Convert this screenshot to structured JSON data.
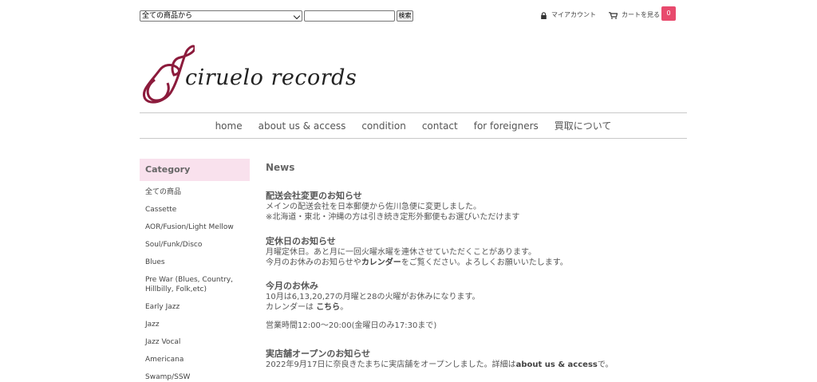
{
  "topbar": {
    "search_select_value": "全ての商品から",
    "search_button": "検索",
    "account_label": "マイアカウント",
    "cart_label": "カートを見る",
    "cart_count": "0"
  },
  "brand": {
    "logo_text": "ciruelo records",
    "logo_color": "#8c1b3c"
  },
  "nav": {
    "items": [
      "home",
      "about us & access",
      "condition",
      "contact",
      "for foreigners",
      "買取について"
    ]
  },
  "sidebar": {
    "header": "Category",
    "items": [
      "全ての商品",
      "Cassette",
      "AOR/Fusion/Light Mellow",
      "Soul/Funk/Disco",
      "Blues",
      "Pre War (Blues, Country, Hillbilly, Folk,etc)",
      "Early Jazz",
      "Jazz",
      "Jazz Vocal",
      "Americana",
      "Swamp/SSW"
    ]
  },
  "news": {
    "title": "News",
    "items": [
      {
        "heading": "配送会社変更のお知らせ",
        "line1": "メインの配送会社を日本郵便から佐川急便に変更しました。",
        "line2": "※北海道・東北・沖縄の方は引き続き定形外郵便もお選びいただけます"
      },
      {
        "heading": "定休日のお知らせ",
        "line1": "月曜定休日。あと月に一回火曜水曜を連休させていただくことがあります。",
        "line2_pre": "今月のお休みのお知らせや",
        "line2_link": "カレンダー",
        "line2_post": "をご覧ください。よろしくお願いいたします。"
      },
      {
        "heading": "今月のお休み",
        "line1": "10月は6,13,20,27の月曜と28の火曜がお休みになります。",
        "line2_pre": "カレンダーは ",
        "line2_link": "こちら",
        "line2_post": "。",
        "line3": "営業時間12:00～20:00(金曜日のみ17:30まで)"
      },
      {
        "heading": "実店舗オープンのお知らせ",
        "line1_pre": "2022年9月17日に奈良きたまちに実店舗をオープンしました。詳細は",
        "line1_link": "about us & access",
        "line1_post": "で。"
      }
    ]
  },
  "colors": {
    "accent_pink": "#e84a6d",
    "category_bg": "#f9e1ed"
  }
}
